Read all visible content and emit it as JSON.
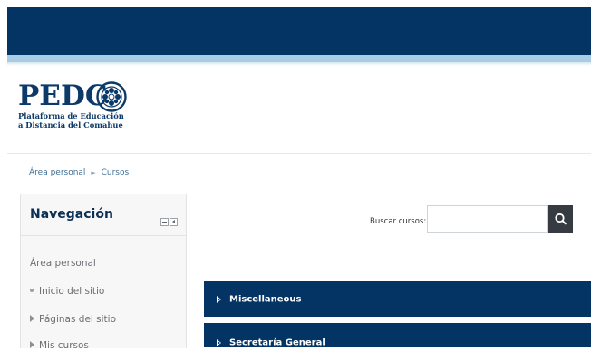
{
  "header": {
    "logo": {
      "wordmark": "PEDC",
      "subtitle_line1": "Plataforma de Educación",
      "subtitle_line2": "a Distancia del Comahue"
    },
    "colors": {
      "topbar": "#043464",
      "stripe": "#a7cde4"
    }
  },
  "breadcrumb": {
    "items": [
      "Área personal",
      "Cursos"
    ],
    "separator": "►"
  },
  "navigation": {
    "title": "Navegación",
    "items": [
      {
        "label": "Área personal",
        "marker": "none"
      },
      {
        "label": "Inicio del sitio",
        "marker": "bullet"
      },
      {
        "label": "Páginas del sitio",
        "marker": "triangle"
      },
      {
        "label": "Mis cursos",
        "marker": "triangle"
      }
    ]
  },
  "search": {
    "label": "Buscar cursos:",
    "value": "",
    "placeholder": "",
    "button_icon": "search-icon"
  },
  "categories": [
    {
      "label": "Miscellaneous"
    },
    {
      "label": "Secretaría General"
    }
  ]
}
